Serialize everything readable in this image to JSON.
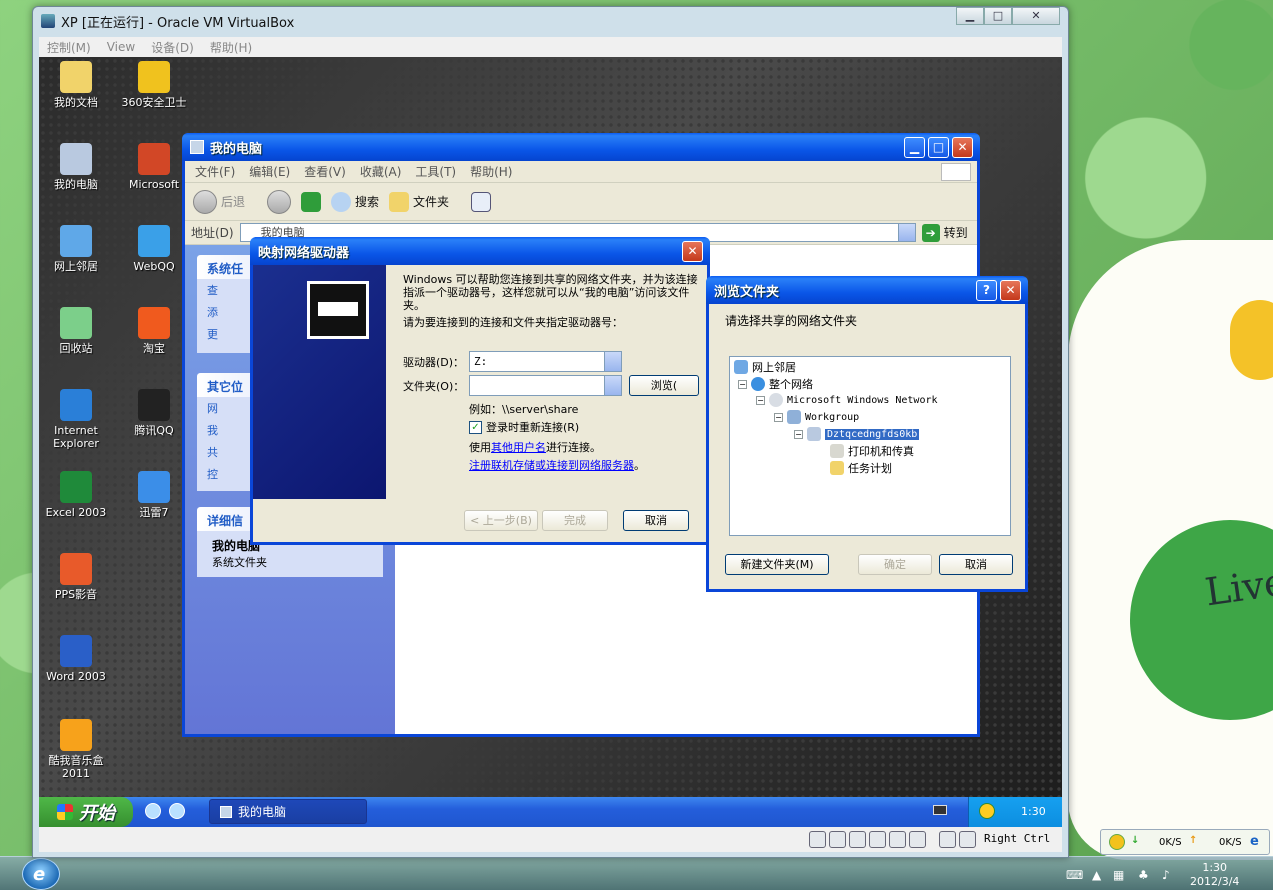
{
  "vbox": {
    "title": "XP [正在运行] - Oracle VM VirtualBox",
    "menu": [
      "控制(M)",
      "View",
      "设备(D)",
      "帮助(H)"
    ],
    "host_key": "Right Ctrl"
  },
  "desktop_icons": [
    {
      "label": "我的文档",
      "icon": "my-documents-icon",
      "color": "#f1d36a"
    },
    {
      "label": "360安全卫士",
      "icon": "360-safe-icon",
      "color": "#f0c21e"
    },
    {
      "label": "我的电脑",
      "icon": "my-computer-icon",
      "color": "#b9c9e0"
    },
    {
      "label": "Microsoft",
      "icon": "powerpoint-icon",
      "color": "#d24726"
    },
    {
      "label": "网上邻居",
      "icon": "network-places-icon",
      "color": "#5fa8e8"
    },
    {
      "label": "WebQQ",
      "icon": "webqq-icon",
      "color": "#3aa0e8"
    },
    {
      "label": "回收站",
      "icon": "recycle-bin-icon",
      "color": "#7ccf8a"
    },
    {
      "label": "淘宝",
      "icon": "taobao-icon",
      "color": "#f05a1e"
    },
    {
      "label": "Internet Explorer",
      "icon": "ie-icon",
      "color": "#2a7fd8"
    },
    {
      "label": "腾讯QQ",
      "icon": "qq-penguin-icon",
      "color": "#222222"
    },
    {
      "label": "Excel 2003",
      "icon": "excel-icon",
      "color": "#1f8a3a"
    },
    {
      "label": "迅雷7",
      "icon": "xunlei-icon",
      "color": "#3b8ee8"
    },
    {
      "label": "PPS影音",
      "icon": "pps-icon",
      "color": "#e85a2a"
    },
    {
      "label": "Word 2003",
      "icon": "word-icon",
      "color": "#2a5fc8"
    },
    {
      "label": "酷我音乐盒2011",
      "icon": "kuwo-music-icon",
      "color": "#f7a21b"
    }
  ],
  "xp_taskbar": {
    "start": "开始",
    "task_button": "我的电脑",
    "time": "1:30"
  },
  "mycomputer": {
    "title": "我的电脑",
    "menu": [
      "文件(F)",
      "编辑(E)",
      "查看(V)",
      "收藏(A)",
      "工具(T)",
      "帮助(H)"
    ],
    "back": "后退",
    "search": "搜索",
    "folders": "文件夹",
    "address_label": "地址(D)",
    "address_value": "我的电脑",
    "go": "转到",
    "system_tasks": "系统任",
    "system_task_items": [
      "查",
      "添",
      "更"
    ],
    "other_places": "其它位",
    "other_place_items": [
      "网",
      "我",
      "共",
      "控"
    ],
    "details": "详细信",
    "details_title": "我的电脑",
    "details_sub": "系统文件夹"
  },
  "mapdrive": {
    "title": "映射网络驱动器",
    "intro": "Windows 可以帮助您连接到共享的网络文件夹，并为该连接指派一个驱动器号，这样您就可以从“我的电脑”访问该文件夹。",
    "instruction": "请为要连接到的连接和文件夹指定驱动器号：",
    "drive_label": "驱动器(D)：",
    "drive_value": "Z:",
    "folder_label": "文件夹(O)：",
    "folder_value": "",
    "browse": "浏览(",
    "example": "例如：\\\\server\\share",
    "reconnect": "登录时重新连接(R)",
    "other_user_prefix": "使用",
    "other_user_link": "其他用户名",
    "other_user_suffix": "进行连接。",
    "register_link": "注册联机存储或连接到网络服务器",
    "register_suffix": "。",
    "back_btn": "< 上一步(B)",
    "finish_btn": "完成",
    "cancel_btn": "取消"
  },
  "browse": {
    "title": "浏览文件夹",
    "prompt": "请选择共享的网络文件夹",
    "tree": [
      {
        "label": "网上邻居",
        "icon": "network-places-icon"
      },
      {
        "label": "整个网络",
        "icon": "entire-network-icon"
      },
      {
        "label": "Microsoft Windows Network",
        "icon": "windows-network-icon"
      },
      {
        "label": "Workgroup",
        "icon": "workgroup-icon"
      },
      {
        "label": "Dztqcedngfds0kb",
        "icon": "computer-icon"
      },
      {
        "label": "打印机和传真",
        "icon": "printers-icon"
      },
      {
        "label": "任务计划",
        "icon": "scheduled-tasks-icon"
      }
    ],
    "new_folder": "新建文件夹(M)",
    "ok": "确定",
    "cancel": "取消"
  },
  "host": {
    "net_down": "0K/S",
    "net_up": "0K/S",
    "time": "1:30",
    "date": "2012/3/4"
  }
}
